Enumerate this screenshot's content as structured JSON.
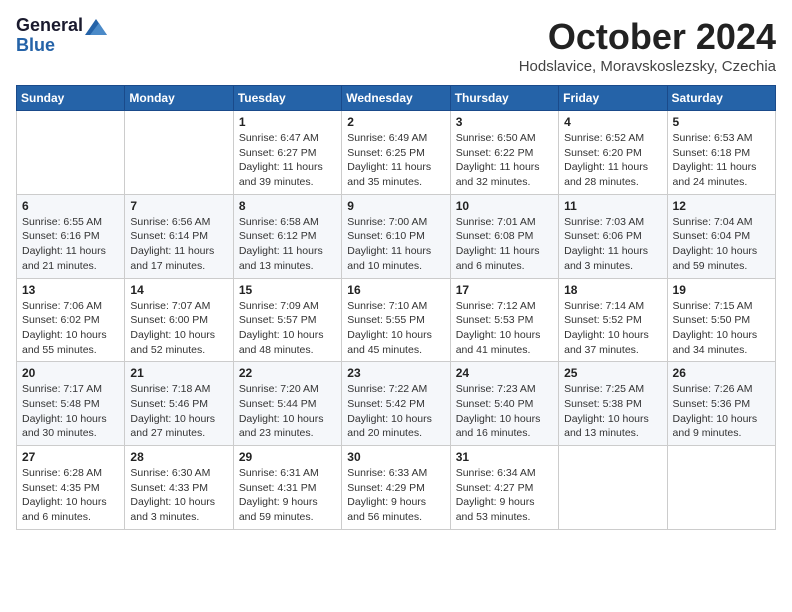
{
  "header": {
    "logo_line1": "General",
    "logo_line2": "Blue",
    "month": "October 2024",
    "location": "Hodslavice, Moravskoslezsky, Czechia"
  },
  "weekdays": [
    "Sunday",
    "Monday",
    "Tuesday",
    "Wednesday",
    "Thursday",
    "Friday",
    "Saturday"
  ],
  "weeks": [
    [
      {
        "day": "",
        "info": ""
      },
      {
        "day": "",
        "info": ""
      },
      {
        "day": "1",
        "info": "Sunrise: 6:47 AM\nSunset: 6:27 PM\nDaylight: 11 hours and 39 minutes."
      },
      {
        "day": "2",
        "info": "Sunrise: 6:49 AM\nSunset: 6:25 PM\nDaylight: 11 hours and 35 minutes."
      },
      {
        "day": "3",
        "info": "Sunrise: 6:50 AM\nSunset: 6:22 PM\nDaylight: 11 hours and 32 minutes."
      },
      {
        "day": "4",
        "info": "Sunrise: 6:52 AM\nSunset: 6:20 PM\nDaylight: 11 hours and 28 minutes."
      },
      {
        "day": "5",
        "info": "Sunrise: 6:53 AM\nSunset: 6:18 PM\nDaylight: 11 hours and 24 minutes."
      }
    ],
    [
      {
        "day": "6",
        "info": "Sunrise: 6:55 AM\nSunset: 6:16 PM\nDaylight: 11 hours and 21 minutes."
      },
      {
        "day": "7",
        "info": "Sunrise: 6:56 AM\nSunset: 6:14 PM\nDaylight: 11 hours and 17 minutes."
      },
      {
        "day": "8",
        "info": "Sunrise: 6:58 AM\nSunset: 6:12 PM\nDaylight: 11 hours and 13 minutes."
      },
      {
        "day": "9",
        "info": "Sunrise: 7:00 AM\nSunset: 6:10 PM\nDaylight: 11 hours and 10 minutes."
      },
      {
        "day": "10",
        "info": "Sunrise: 7:01 AM\nSunset: 6:08 PM\nDaylight: 11 hours and 6 minutes."
      },
      {
        "day": "11",
        "info": "Sunrise: 7:03 AM\nSunset: 6:06 PM\nDaylight: 11 hours and 3 minutes."
      },
      {
        "day": "12",
        "info": "Sunrise: 7:04 AM\nSunset: 6:04 PM\nDaylight: 10 hours and 59 minutes."
      }
    ],
    [
      {
        "day": "13",
        "info": "Sunrise: 7:06 AM\nSunset: 6:02 PM\nDaylight: 10 hours and 55 minutes."
      },
      {
        "day": "14",
        "info": "Sunrise: 7:07 AM\nSunset: 6:00 PM\nDaylight: 10 hours and 52 minutes."
      },
      {
        "day": "15",
        "info": "Sunrise: 7:09 AM\nSunset: 5:57 PM\nDaylight: 10 hours and 48 minutes."
      },
      {
        "day": "16",
        "info": "Sunrise: 7:10 AM\nSunset: 5:55 PM\nDaylight: 10 hours and 45 minutes."
      },
      {
        "day": "17",
        "info": "Sunrise: 7:12 AM\nSunset: 5:53 PM\nDaylight: 10 hours and 41 minutes."
      },
      {
        "day": "18",
        "info": "Sunrise: 7:14 AM\nSunset: 5:52 PM\nDaylight: 10 hours and 37 minutes."
      },
      {
        "day": "19",
        "info": "Sunrise: 7:15 AM\nSunset: 5:50 PM\nDaylight: 10 hours and 34 minutes."
      }
    ],
    [
      {
        "day": "20",
        "info": "Sunrise: 7:17 AM\nSunset: 5:48 PM\nDaylight: 10 hours and 30 minutes."
      },
      {
        "day": "21",
        "info": "Sunrise: 7:18 AM\nSunset: 5:46 PM\nDaylight: 10 hours and 27 minutes."
      },
      {
        "day": "22",
        "info": "Sunrise: 7:20 AM\nSunset: 5:44 PM\nDaylight: 10 hours and 23 minutes."
      },
      {
        "day": "23",
        "info": "Sunrise: 7:22 AM\nSunset: 5:42 PM\nDaylight: 10 hours and 20 minutes."
      },
      {
        "day": "24",
        "info": "Sunrise: 7:23 AM\nSunset: 5:40 PM\nDaylight: 10 hours and 16 minutes."
      },
      {
        "day": "25",
        "info": "Sunrise: 7:25 AM\nSunset: 5:38 PM\nDaylight: 10 hours and 13 minutes."
      },
      {
        "day": "26",
        "info": "Sunrise: 7:26 AM\nSunset: 5:36 PM\nDaylight: 10 hours and 9 minutes."
      }
    ],
    [
      {
        "day": "27",
        "info": "Sunrise: 6:28 AM\nSunset: 4:35 PM\nDaylight: 10 hours and 6 minutes."
      },
      {
        "day": "28",
        "info": "Sunrise: 6:30 AM\nSunset: 4:33 PM\nDaylight: 10 hours and 3 minutes."
      },
      {
        "day": "29",
        "info": "Sunrise: 6:31 AM\nSunset: 4:31 PM\nDaylight: 9 hours and 59 minutes."
      },
      {
        "day": "30",
        "info": "Sunrise: 6:33 AM\nSunset: 4:29 PM\nDaylight: 9 hours and 56 minutes."
      },
      {
        "day": "31",
        "info": "Sunrise: 6:34 AM\nSunset: 4:27 PM\nDaylight: 9 hours and 53 minutes."
      },
      {
        "day": "",
        "info": ""
      },
      {
        "day": "",
        "info": ""
      }
    ]
  ]
}
